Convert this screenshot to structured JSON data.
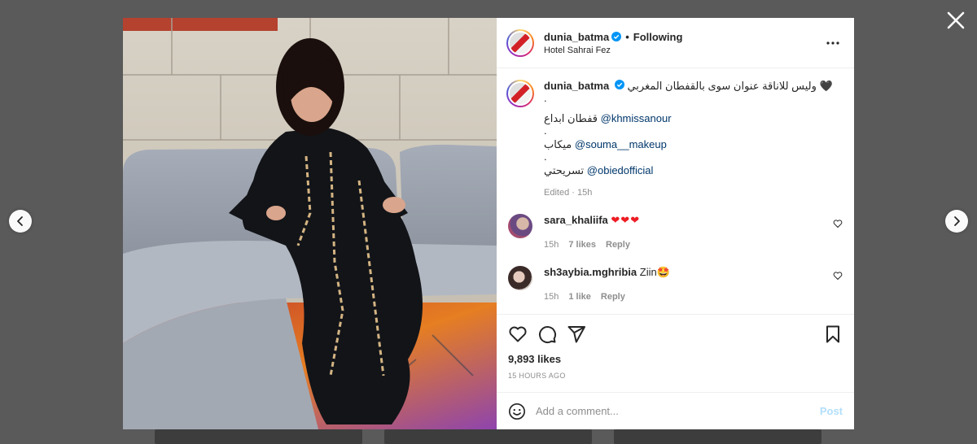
{
  "modal": {
    "close_icon": "close-icon",
    "prev_icon": "chevron-left-icon",
    "next_icon": "chevron-right-icon"
  },
  "post": {
    "username": "dunia_batma",
    "separator": "•",
    "follow_status": "Following",
    "location": "Hotel Sahrai Fez",
    "more_icon": "more-horizontal-icon"
  },
  "caption": {
    "username": "dunia_batma",
    "line1": "وليس للاناقة عنوان سوى بالقفطان المغربي 🖤",
    "dot": ".",
    "line2_text": "قفطان ابداع",
    "line2_mention": "@khmissanour",
    "line3_text": "ميكاب",
    "line3_mention": "@souma__makeup",
    "line4_text": "تسريحتي",
    "line4_mention": "@obiedofficial",
    "meta": "Edited · 15h"
  },
  "comments": [
    {
      "username": "sara_khaliifa",
      "text": "❤❤❤",
      "time": "15h",
      "likes": "7 likes",
      "reply": "Reply"
    },
    {
      "username": "sh3aybia.mghribia",
      "text": "Ziin🤩",
      "time": "15h",
      "likes": "1 like",
      "reply": "Reply"
    }
  ],
  "actions": {
    "like_icon": "heart-icon",
    "comment_icon": "comment-icon",
    "share_icon": "send-icon",
    "save_icon": "bookmark-icon",
    "likes": "9,893 likes",
    "time_ago": "15 HOURS AGO"
  },
  "add_comment": {
    "emoji_icon": "emoji-icon",
    "placeholder": "Add a comment...",
    "post_label": "Post"
  },
  "colors": {
    "link": "#00376b",
    "verified": "#0095f6",
    "post_disabled": "#b2dffc",
    "overlay": "#5c5c5c"
  }
}
